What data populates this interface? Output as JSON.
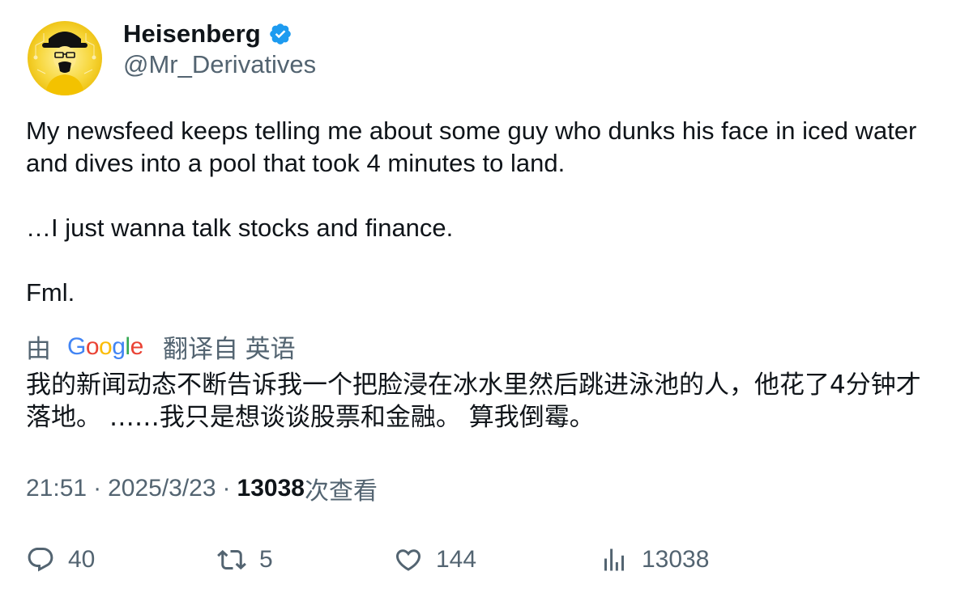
{
  "author": {
    "display_name": "Heisenberg",
    "handle": "@Mr_Derivatives",
    "verified_icon": "verified-badge-icon",
    "badge_color": "#1d9bf0"
  },
  "tweet": {
    "paragraphs": [
      "My newsfeed keeps telling me about some guy who dunks his face in iced water and dives into a pool that took 4 minutes to land.",
      "…I just wanna talk stocks and finance.",
      "Fml."
    ]
  },
  "translation": {
    "by_label": "由",
    "provider": "Google",
    "from_label": "翻译自 英语",
    "text": "我的新闻动态不断告诉我一个把脸浸在冰水里然后跳进泳池的人，他花了4分钟才落地。 ……我只是想谈谈股票和金融。 算我倒霉。"
  },
  "meta": {
    "time": "21:51",
    "separator": "·",
    "date": "2025/3/23",
    "views_count": "13038",
    "views_label": "次查看"
  },
  "actions": {
    "replies": "40",
    "retweets": "5",
    "likes": "144",
    "views": "13038"
  },
  "colors": {
    "text": "#0f1419",
    "secondary": "#536471",
    "accent": "#1d9bf0",
    "avatar_bg": "#f5c518"
  }
}
